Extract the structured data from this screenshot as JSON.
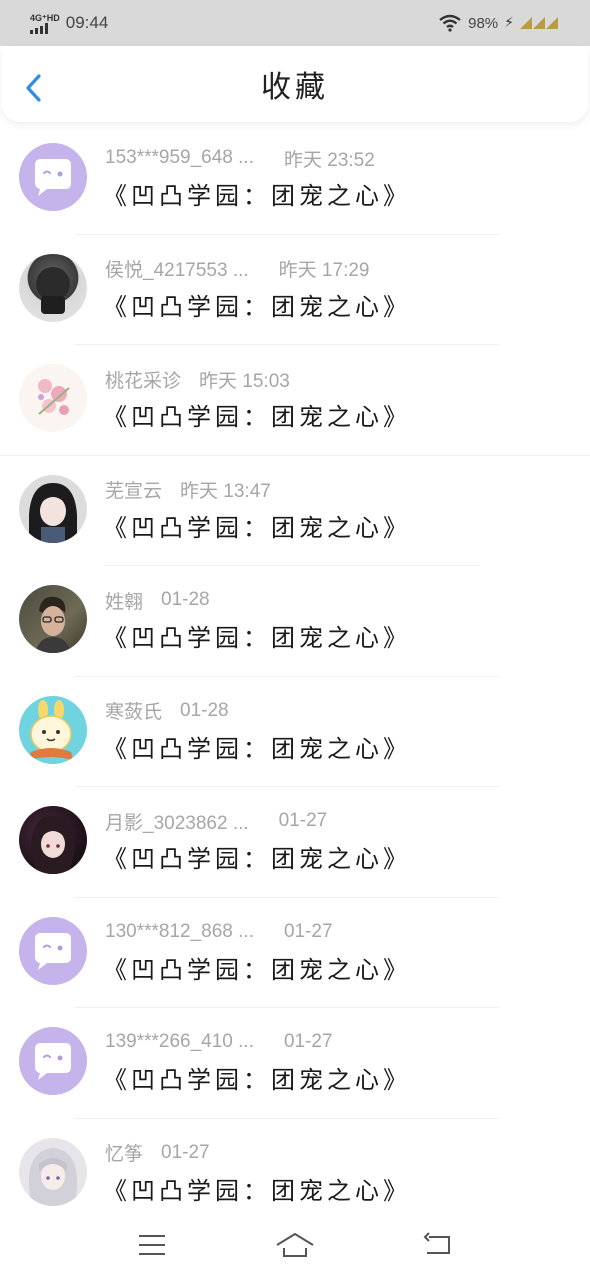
{
  "status_bar": {
    "network": "4G⁺HD",
    "time": "09:44",
    "battery": "98%"
  },
  "header": {
    "title": "收藏"
  },
  "items": [
    {
      "name": "153***959_648 ...",
      "time": "昨天 23:52",
      "title": "《凹凸学园：团宠之心》",
      "avatar": "default-chat-avatar"
    },
    {
      "name": "侯悦_4217553 ...",
      "time": "昨天 17:29",
      "title": "《凹凸学园：团宠之心》",
      "avatar": "dark-portrait-avatar"
    },
    {
      "name": "桃花采诊",
      "time": "昨天 15:03",
      "title": "《凹凸学园：团宠之心》",
      "avatar": "flower-avatar"
    },
    {
      "name": "芜宣云",
      "time": "昨天 13:47",
      "title": "《凹凸学园：团宠之心》",
      "avatar": "anime-girl-avatar"
    },
    {
      "name": "姓翱",
      "time": "01-28",
      "title": "《凹凸学园：团宠之心》",
      "avatar": "man-photo-avatar"
    },
    {
      "name": "寒蔹氏",
      "time": "01-28",
      "title": "《凹凸学园：团宠之心》",
      "avatar": "cartoon-bunny-avatar"
    },
    {
      "name": "月影_3023862 ...",
      "time": "01-27",
      "title": "《凹凸学园：团宠之心》",
      "avatar": "anime-dark-avatar"
    },
    {
      "name": "130***812_868 ...",
      "time": "01-27",
      "title": "《凹凸学园：团宠之心》",
      "avatar": "default-chat-avatar"
    },
    {
      "name": "139***266_410 ...",
      "time": "01-27",
      "title": "《凹凸学园：团宠之心》",
      "avatar": "default-chat-avatar"
    },
    {
      "name": "忆筝",
      "time": "01-27",
      "title": "《凹凸学园：团宠之心》",
      "avatar": "anime-white-hair-avatar"
    }
  ],
  "colors": {
    "accent": "#2e8ee6",
    "default_avatar_bg": "#c5b3ec",
    "meta_text": "#a6a6a6"
  }
}
